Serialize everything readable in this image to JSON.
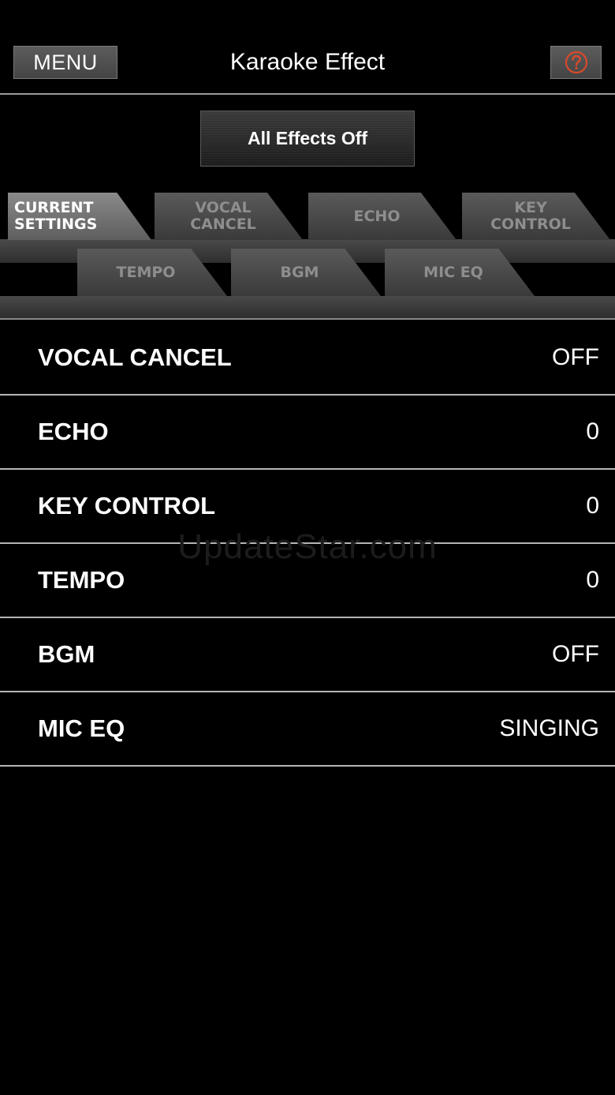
{
  "header": {
    "menu_label": "MENU",
    "title": "Karaoke Effect",
    "help_icon": "question-mark-icon",
    "help_color": "#d84a2c"
  },
  "all_effects_off_label": "All Effects Off",
  "tabs": [
    {
      "line1": "CURRENT",
      "line2": "SETTINGS",
      "active": true
    },
    {
      "line1": "VOCAL",
      "line2": "CANCEL",
      "active": false
    },
    {
      "line1": "ECHO",
      "line2": "",
      "active": false
    },
    {
      "line1": "KEY",
      "line2": "CONTROL",
      "active": false
    },
    {
      "line1": "TEMPO",
      "line2": "",
      "active": false
    },
    {
      "line1": "BGM",
      "line2": "",
      "active": false
    },
    {
      "line1": "MIC EQ",
      "line2": "",
      "active": false
    }
  ],
  "settings": [
    {
      "label": "VOCAL CANCEL",
      "value": "OFF"
    },
    {
      "label": "ECHO",
      "value": "0"
    },
    {
      "label": "KEY CONTROL",
      "value": "0"
    },
    {
      "label": "TEMPO",
      "value": "0"
    },
    {
      "label": "BGM",
      "value": "OFF"
    },
    {
      "label": "MIC EQ",
      "value": "SINGING"
    }
  ],
  "watermark": "UpdateStar.com"
}
